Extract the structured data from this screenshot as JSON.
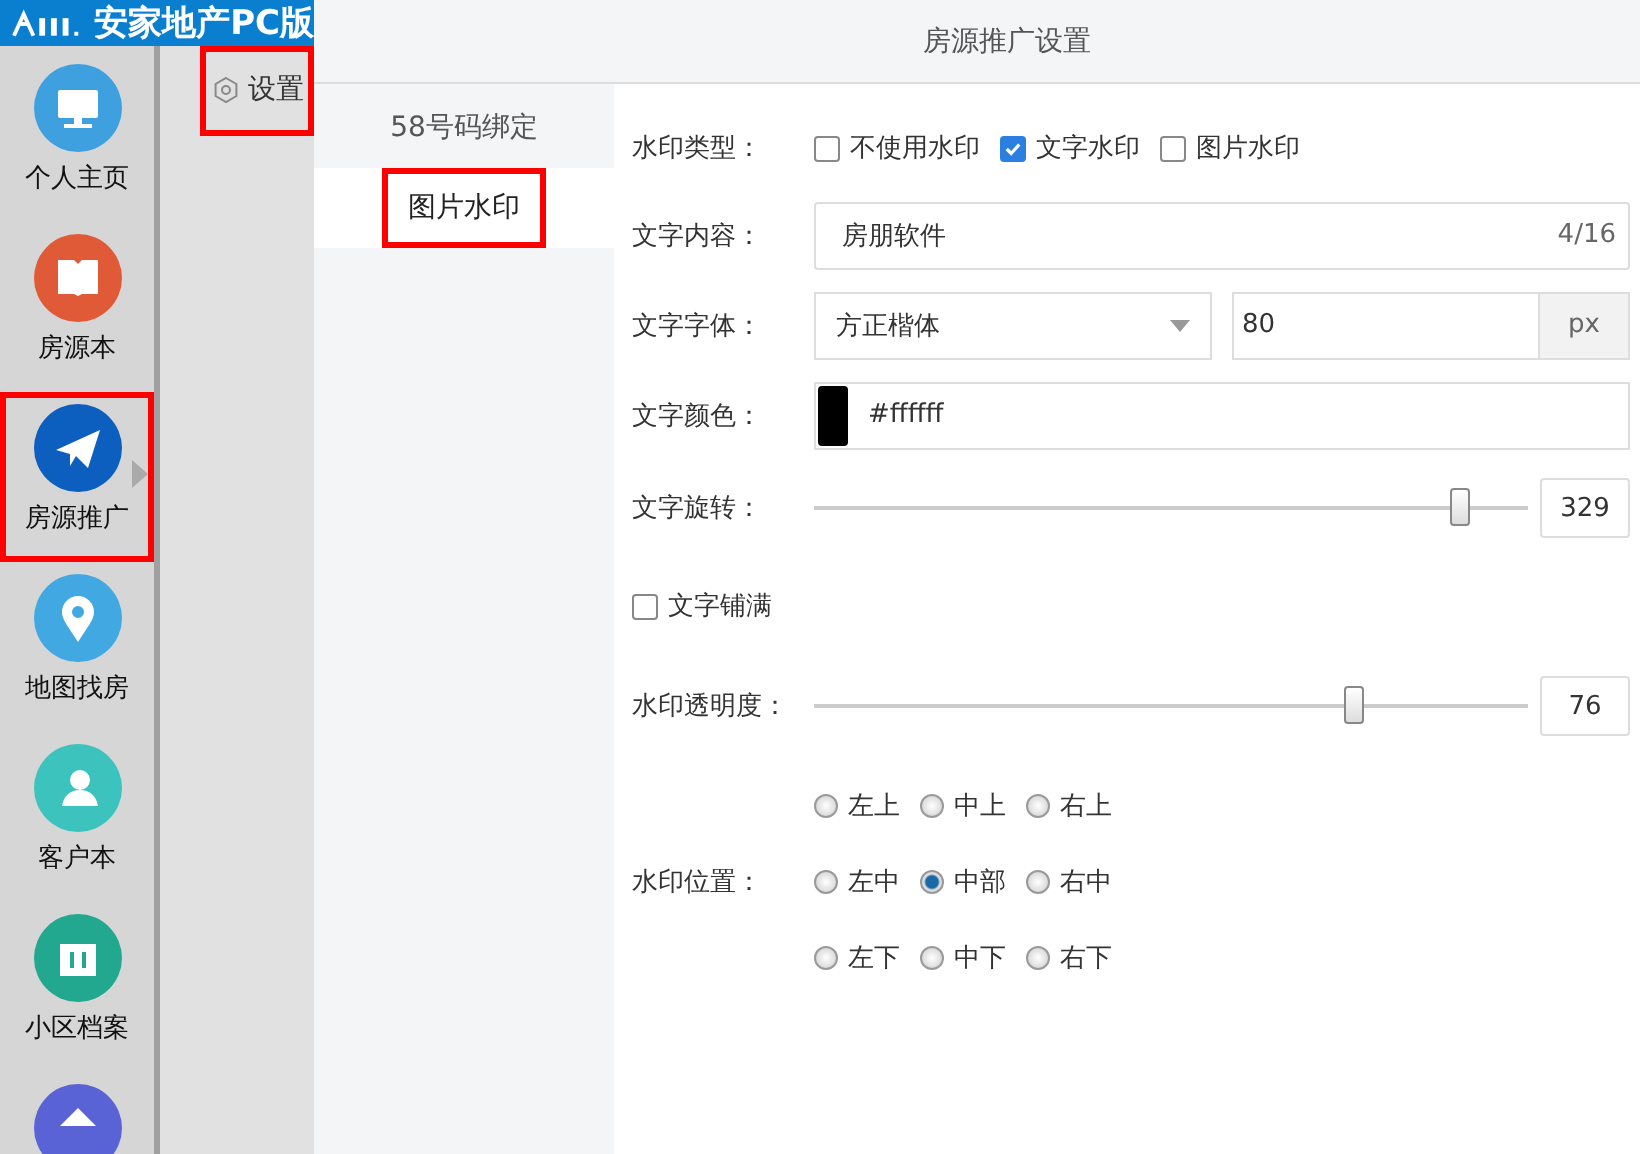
{
  "app": {
    "title": "安家地产PC版"
  },
  "nav": [
    {
      "label": "个人主页",
      "color": "#3fa0e0",
      "selected": false,
      "highlighted": false
    },
    {
      "label": "房源本",
      "color": "#e05a38",
      "selected": false,
      "highlighted": false
    },
    {
      "label": "房源推广",
      "color": "#0c5fbf",
      "selected": true,
      "highlighted": true
    },
    {
      "label": "地图找房",
      "color": "#42a8e2",
      "selected": false,
      "highlighted": false
    },
    {
      "label": "客户本",
      "color": "#3cc3bd",
      "selected": false,
      "highlighted": false
    },
    {
      "label": "小区档案",
      "color": "#22a88e",
      "selected": false,
      "highlighted": false
    },
    {
      "color": "#5a63d6",
      "selected": false,
      "highlighted": false
    }
  ],
  "sub_menu": [
    {
      "label": "设置",
      "highlighted": true
    }
  ],
  "page_title": "房源推广设置",
  "tabs": [
    {
      "label": "58号码绑定",
      "selected": false,
      "highlighted": false
    },
    {
      "label": "图片水印",
      "selected": true,
      "highlighted": true
    }
  ],
  "form": {
    "watermark_type": {
      "label": "水印类型：",
      "options": [
        {
          "label": "不使用水印",
          "checked": false
        },
        {
          "label": "文字水印",
          "checked": true
        },
        {
          "label": "图片水印",
          "checked": false
        }
      ]
    },
    "text_content": {
      "label": "文字内容：",
      "value": "房朋软件",
      "counter": "4/16"
    },
    "font": {
      "label": "文字字体：",
      "value": "方正楷体",
      "size": "80",
      "unit": "px"
    },
    "color": {
      "label": "文字颜色：",
      "value": "#ffffff"
    },
    "rotation": {
      "label": "文字旋转：",
      "level": 0.905,
      "reading": "329"
    },
    "fill": {
      "label": "文字铺满",
      "checked": false
    },
    "opacity": {
      "label": "水印透明度：",
      "level": 0.755,
      "reading": "76"
    },
    "position": {
      "label": "水印位置：",
      "rows": [
        [
          {
            "label": "左上",
            "selected": false
          },
          {
            "label": "中上",
            "selected": false
          },
          {
            "label": "右上",
            "selected": false
          }
        ],
        [
          {
            "label": "左中",
            "selected": false
          },
          {
            "label": "中部",
            "selected": true
          },
          {
            "label": "右中",
            "selected": false
          }
        ],
        [
          {
            "label": "左下",
            "selected": false
          },
          {
            "label": "中下",
            "selected": false
          },
          {
            "label": "右下",
            "selected": false
          }
        ]
      ]
    }
  }
}
